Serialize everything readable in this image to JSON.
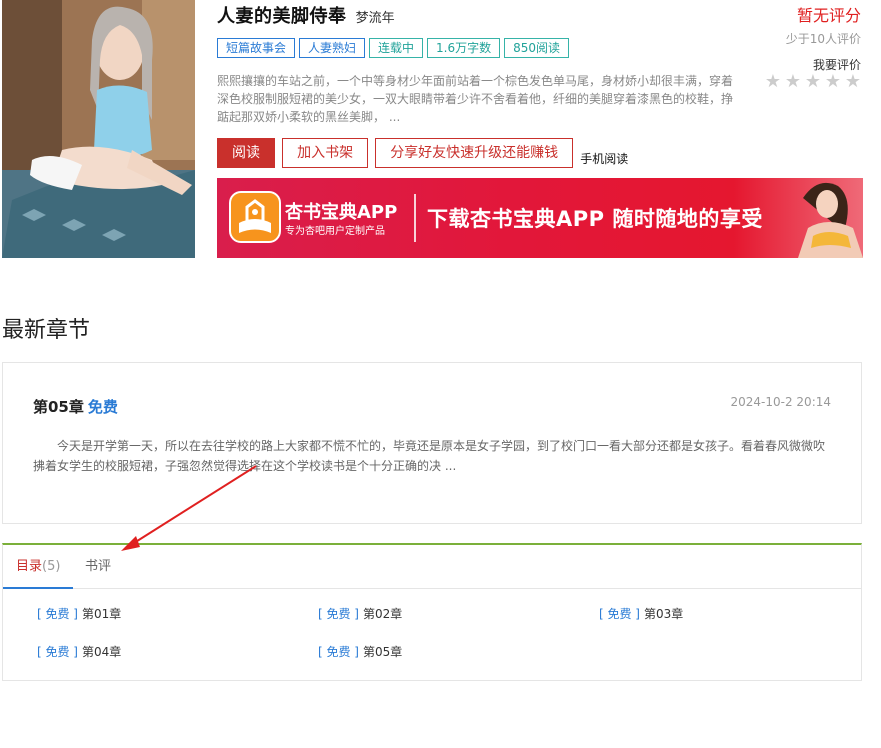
{
  "book": {
    "title": "人妻的美脚侍奉",
    "author": "梦流年",
    "tags": [
      "短篇故事会",
      "人妻熟妇",
      "连载中",
      "1.6万字数",
      "850阅读"
    ],
    "description": "熙熙攘攘的车站之前，一个中等身材少年面前站着一个棕色发色单马尾，身材娇小却很丰满，穿着深色校服制服短裙的美少女，一双大眼睛带着少许不舍看着他，纤细的美腿穿着漆黑色的校鞋，挣踮起那双娇小柔软的黑丝美脚，  ..."
  },
  "rating": {
    "no_score": "暂无评分",
    "few_rated": "少于10人评价",
    "rate_label": "我要评价",
    "stars": 0,
    "max_stars": 5
  },
  "actions": {
    "read": "阅读",
    "add_shelf": "加入书架",
    "share": "分享好友快速升级还能赚钱",
    "mobile": "手机阅读"
  },
  "banner": {
    "app_name": "杏书宝典APP",
    "app_sub": "专为杏吧用户定制产品",
    "slogan": "下载杏书宝典APP 随时随地的享受"
  },
  "latest": {
    "section_title": "最新章节",
    "chapter": "第05章",
    "free": "免费",
    "date": "2024-10-2 20:14",
    "excerpt": "今天是开学第一天，所以在去往学校的路上大家都不慌不忙的，毕竟还是原本是女子学园，到了校门口一看大部分还都是女孩子。看着春风微微吹拂着女学生的校服短裙，子强忽然觉得选择在这个学校读书是个十分正确的决 ..."
  },
  "tabs": {
    "toc_label": "目录",
    "toc_count": "(5)",
    "review_label": "书评"
  },
  "toc": [
    {
      "free": "[ 免费 ]",
      "title": "第01章"
    },
    {
      "free": "[ 免费 ]",
      "title": "第02章"
    },
    {
      "free": "[ 免费 ]",
      "title": "第03章"
    },
    {
      "free": "[ 免费 ]",
      "title": "第04章"
    },
    {
      "free": "[ 免费 ]",
      "title": "第05章"
    }
  ],
  "colors": {
    "accent_red": "#c9302c",
    "link_blue": "#2a7bd5",
    "tab_border_green": "#7bb03a",
    "annotation_arrow": "#e02020"
  }
}
